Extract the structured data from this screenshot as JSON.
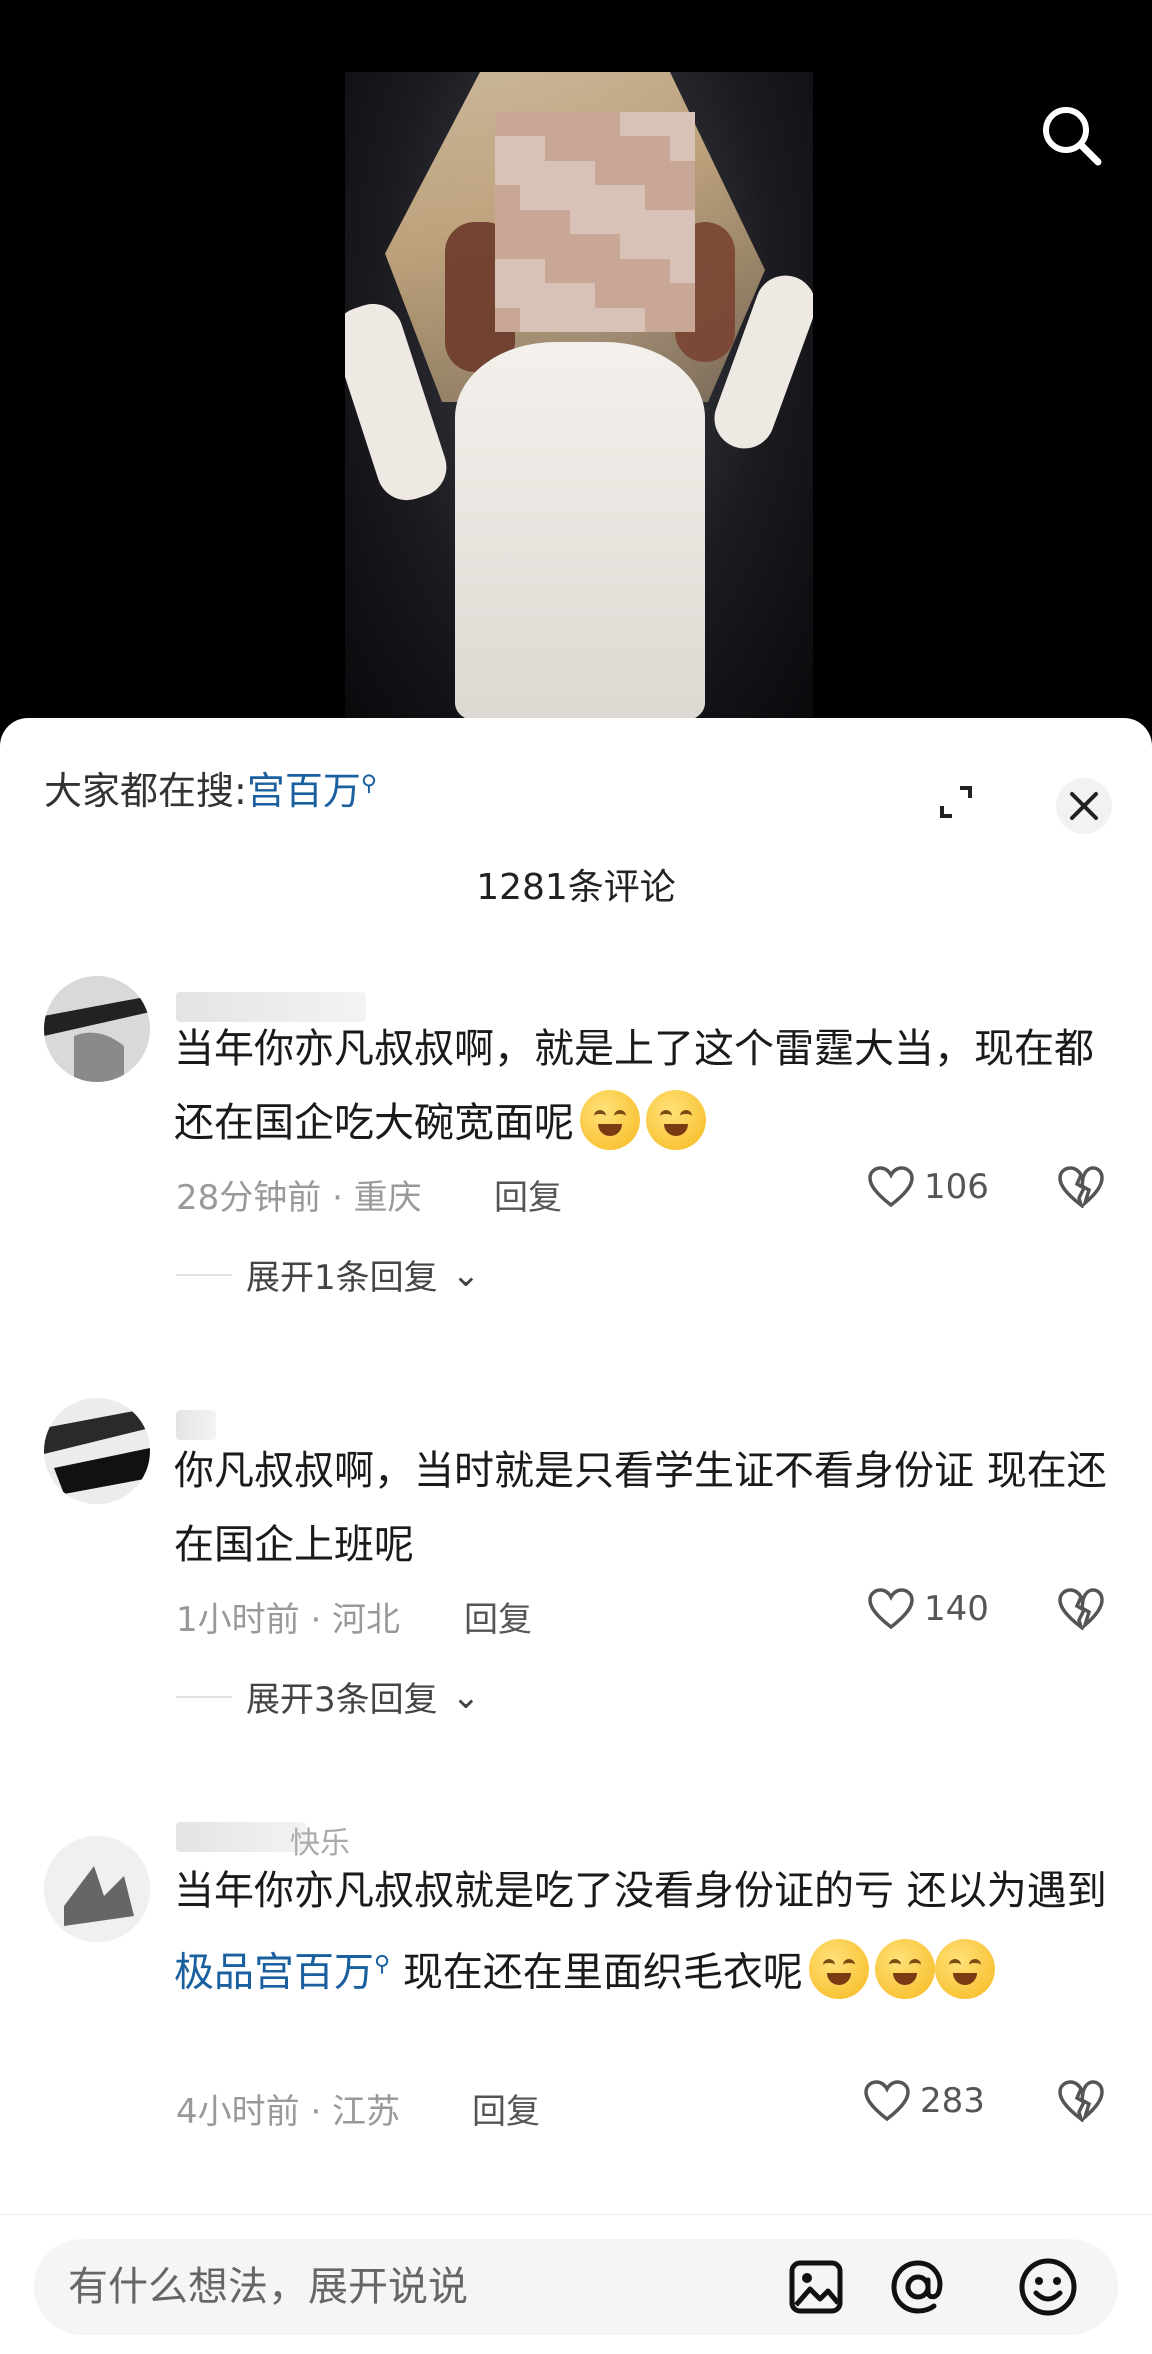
{
  "trending": {
    "prefix": "大家都在搜:",
    "keyword": "宫百万"
  },
  "comment_count": "1281条评论",
  "comments": [
    {
      "text": "当年你亦凡叔叔啊，就是上了这个雷霆大当，现在都还在国企吃大碗宽面呢",
      "time_location": "28分钟前 · 重庆",
      "reply_label": "回复",
      "likes": "106",
      "expand_label": "展开1条回复"
    },
    {
      "text": "你凡叔叔啊，当时就是只看学生证不看身份证  现在还在国企上班呢",
      "time_location": "1小时前 · 河北",
      "reply_label": "回复",
      "likes": "140",
      "expand_label": "展开3条回复"
    },
    {
      "username_partial": "快乐",
      "text_before": "当年你亦凡叔叔就是吃了没看身份证的亏 还以为遇到",
      "text_link": "极品宫百万",
      "text_after": " 现在还在里面织毛衣呢",
      "time_location": "4小时前 · 江苏",
      "reply_label": "回复",
      "likes": "283"
    }
  ],
  "input": {
    "placeholder": "有什么想法，展开说说"
  },
  "icons": {
    "top_search": "search-icon",
    "expand": "fullscreen-icon",
    "close": "close-icon",
    "like": "heart-icon",
    "dislike": "broken-heart-icon",
    "image": "image-icon",
    "mention": "at-icon",
    "emoji": "emoji-icon"
  },
  "colors": {
    "link": "#1a5f9e",
    "meta": "#999999"
  }
}
